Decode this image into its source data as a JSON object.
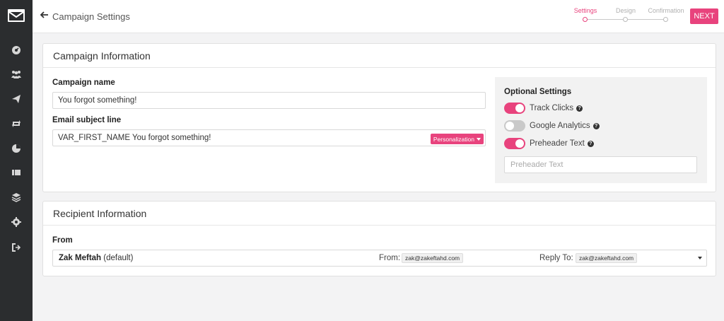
{
  "header": {
    "title": "Campaign Settings",
    "steps": [
      {
        "label": "Settings",
        "active": true
      },
      {
        "label": "Design",
        "active": false
      },
      {
        "label": "Confirmation",
        "active": false
      }
    ],
    "next_label": "NEXT"
  },
  "sidebar": {
    "icons": [
      "logo-icon",
      "dashboard-icon",
      "users-icon",
      "send-icon",
      "loop-icon",
      "reports-icon",
      "ticket-icon",
      "layers-icon",
      "gear-icon",
      "logout-icon"
    ]
  },
  "campaign_info": {
    "title": "Campaign Information",
    "name_label": "Campaign name",
    "name_value": "You forgot something!",
    "subject_label": "Email subject line",
    "subject_value": "VAR_FIRST_NAME You forgot something!",
    "personalization_label": "Personalization",
    "optional": {
      "title": "Optional Settings",
      "toggles": [
        {
          "label": "Track Clicks",
          "on": true
        },
        {
          "label": "Google Analytics",
          "on": false
        },
        {
          "label": "Preheader Text",
          "on": true
        }
      ],
      "preheader_placeholder": "Preheader Text"
    }
  },
  "recipient_info": {
    "title": "Recipient Information",
    "from_label": "From",
    "sender_name": "Zak Meftah",
    "sender_suffix": " (default)",
    "from_email_label": "From:",
    "from_email": "zak@zakeftahd.com",
    "reply_label": "Reply To:",
    "reply_email": "zak@zakeftahd.com"
  },
  "colors": {
    "accent": "#e8437d",
    "sidebar": "#2b2d2f"
  }
}
